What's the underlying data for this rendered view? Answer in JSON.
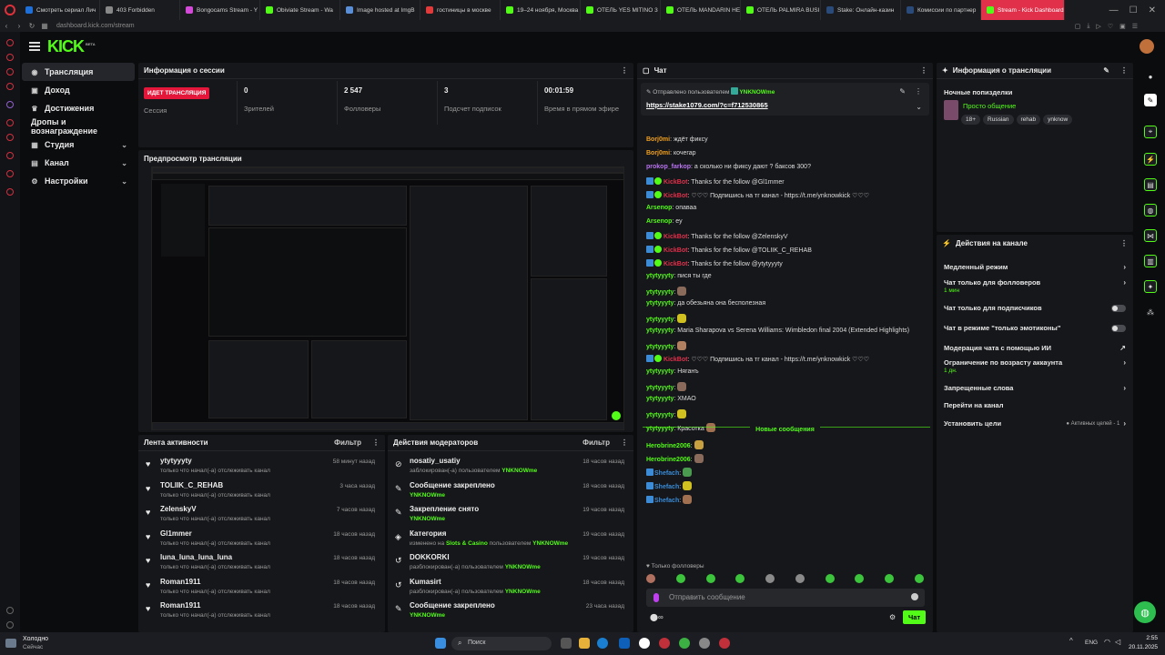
{
  "browser": {
    "tabs": [
      {
        "label": "Смотреть сериал Лич",
        "fav": "#1f6fd8"
      },
      {
        "label": "403 Forbidden",
        "fav": "#888888"
      },
      {
        "label": "Bongocams Stream - Y",
        "fav": "#d34ad8"
      },
      {
        "label": "Obiviate Stream - Wa",
        "fav": "#53fc18"
      },
      {
        "label": "Image hosted at ImgB",
        "fav": "#5a8fd8"
      },
      {
        "label": "гостиницы в москве",
        "fav": "#e03a3a"
      },
      {
        "label": "19–24 ноября, Москва",
        "fav": "#53fc18"
      },
      {
        "label": "ОТЕЛЬ YES MITINO 3",
        "fav": "#53fc18"
      },
      {
        "label": "ОТЕЛЬ MANDARIN НЕ",
        "fav": "#53fc18"
      },
      {
        "label": "ОТЕЛЬ PALMIRA BUSI",
        "fav": "#53fc18"
      },
      {
        "label": "Stake: Онлайн-казин",
        "fav": "#2a4a7a"
      },
      {
        "label": "Комиссии по партнер",
        "fav": "#2a4a7a"
      },
      {
        "label": "Stream - Kick Dashboard",
        "fav": "#53fc18",
        "active": true
      }
    ],
    "url": "dashboard.kick.com/stream"
  },
  "logo": "KICK",
  "logo_sup": "BETA",
  "nav": {
    "items": [
      {
        "label": "Трансляция",
        "icon": "broadcast-icon",
        "glyph": "◉",
        "active": true
      },
      {
        "label": "Доход",
        "icon": "money-icon",
        "glyph": "▣"
      },
      {
        "label": "Достижения",
        "icon": "trophy-icon",
        "glyph": "♛"
      },
      {
        "label": "Дропы и вознаграждение",
        "icon": "",
        "glyph": ""
      },
      {
        "label": "Студия",
        "icon": "studio-icon",
        "glyph": "▦",
        "chevron": true
      },
      {
        "label": "Канал",
        "icon": "channel-icon",
        "glyph": "▤",
        "chevron": true
      },
      {
        "label": "Настройки",
        "icon": "settings-icon",
        "glyph": "⚙",
        "chevron": true
      }
    ]
  },
  "session": {
    "title": "Информация о сессии",
    "live_badge": "ИДЕТ ТРАНСЛЯЦИЯ",
    "session_label": "Сессия",
    "stats": [
      {
        "value": "0",
        "label": "Зрителей"
      },
      {
        "value": "2 547",
        "label": "Фолловеры"
      },
      {
        "value": "3",
        "label": "Подсчет подписок"
      },
      {
        "value": "00:01:59",
        "label": "Время в прямом эфире"
      }
    ]
  },
  "preview": {
    "title": "Предпросмотр трансляции"
  },
  "activity": {
    "title": "Лента активности",
    "filter": "Фильтр",
    "items": [
      {
        "name": "ytytyyyty",
        "sub": "только что начал(-а) отслеживать канал",
        "time": "58 минут назад"
      },
      {
        "name": "TOLIIK_C_REHAB",
        "sub": "только что начал(-а) отслеживать канал",
        "time": "3 часа назад"
      },
      {
        "name": "ZelenskyV",
        "sub": "только что начал(-а) отслеживать канал",
        "time": "7 часов назад"
      },
      {
        "name": "Gl1mmer",
        "sub": "только что начал(-а) отслеживать канал",
        "time": "18 часов назад"
      },
      {
        "name": "luna_luna_luna_luna",
        "sub": "только что начал(-а) отслеживать канал",
        "time": "18 часов назад"
      },
      {
        "name": "Roman1911",
        "sub": "только что начал(-а) отслеживать канал",
        "time": "18 часов назад"
      },
      {
        "name": "Roman1911",
        "sub": "только что начал(-а) отслеживать канал",
        "time": "18 часов назад"
      }
    ]
  },
  "moderators": {
    "title": "Действия модераторов",
    "filter": "Фильтр",
    "items": [
      {
        "name": "nosatiy_usatiy",
        "sub": "заблокирован(-а) пользователем",
        "user": "YNKNOWme",
        "time": "18 часов назад",
        "icon": "ban-icon",
        "glyph": "⊘"
      },
      {
        "name": "Сообщение закреплено",
        "sub": "",
        "user": "YNKNOWme",
        "time": "18 часов назад",
        "icon": "pin-icon",
        "glyph": "✎"
      },
      {
        "name": "Закрепление снято",
        "sub": "",
        "user": "YNKNOWme",
        "time": "19 часов назад",
        "icon": "unpin-icon",
        "glyph": "✎"
      },
      {
        "name": "Категория",
        "sub": "изменено на",
        "user": "YNKNOWme",
        "extra": "Slots & Casino",
        "extra_suffix": "пользователем",
        "time": "19 часов назад",
        "icon": "category-icon",
        "glyph": "◈"
      },
      {
        "name": "DOKKORKI",
        "sub": "разблокирован(-а) пользователем",
        "user": "YNKNOWme",
        "time": "19 часов назад",
        "icon": "unban-icon",
        "glyph": "↺"
      },
      {
        "name": "Kumasirt",
        "sub": "разблокирован(-а) пользователем",
        "user": "YNKNOWme",
        "time": "18 часов назад",
        "icon": "unban-icon",
        "glyph": "↺"
      },
      {
        "name": "Сообщение закреплено",
        "sub": "",
        "user": "YNKNOWme",
        "time": "23 часа назад",
        "icon": "pin-icon",
        "glyph": "✎"
      }
    ]
  },
  "chat": {
    "title": "Чат",
    "pinned_by": "Отправлено пользователем",
    "pinned_user": "YNKNOWme",
    "pinned_link": "https://stake1079.com/?c=f712530865",
    "new_messages": "Новые сообщения",
    "followers_only": "Только фолловеры",
    "input_placeholder": "Отправить сообщение",
    "send": "Чат",
    "lines": [
      {
        "user": "Borj0mi",
        "color": "#f0a020",
        "text": ": ждёт фиксу"
      },
      {
        "user": "Borj0mi",
        "color": "#f0a020",
        "text": ": кочегар"
      },
      {
        "user": "prokop_farkop",
        "color": "#b874f0",
        "text": ": а сколько ни фиксу дают ? баксов 300?"
      },
      {
        "user": "KickBot",
        "color": "#e0304a",
        "text": ": Thanks for the follow @Gl1mmer",
        "bot": true
      },
      {
        "user": "KickBot",
        "color": "#e0304a",
        "text": ": ♡♡♡ Подпишись на тг канал - https://t.me/ynknowkick ♡♡♡",
        "bot": true
      },
      {
        "user": "Arsenop",
        "color": "#53fc18",
        "text": ": опаваа"
      },
      {
        "user": "Arsenop",
        "color": "#53fc18",
        "text": ": еу"
      },
      {
        "user": "KickBot",
        "color": "#e0304a",
        "text": ": Thanks for the follow @ZelenskyV",
        "bot": true
      },
      {
        "user": "KickBot",
        "color": "#e0304a",
        "text": ": Thanks for the follow @TOLIIK_C_REHAB",
        "bot": true
      },
      {
        "user": "KickBot",
        "color": "#e0304a",
        "text": ": Thanks for the follow @ytytyyyty",
        "bot": true
      },
      {
        "user": "ytytyyyty",
        "color": "#53fc18",
        "text": ": пися ты где"
      },
      {
        "user": "ytytyyyty",
        "color": "#53fc18",
        "text": ":"
      },
      {
        "user": "ytytyyyty",
        "color": "#53fc18",
        "text": ": да обезьяна она бесполезная"
      },
      {
        "user": "ytytyyyty",
        "color": "#53fc18",
        "text": ":"
      },
      {
        "user": "ytytyyyty",
        "color": "#53fc18",
        "text": ": Maria Sharapova vs Serena Williams: Wimbledon final 2004 (Extended Highlights)"
      },
      {
        "user": "ytytyyyty",
        "color": "#53fc18",
        "text": ":"
      },
      {
        "user": "KickBot",
        "color": "#e0304a",
        "text": ": ♡♡♡ Подпишись на тг канал - https://t.me/ynknowkick ♡♡♡",
        "bot": true
      },
      {
        "user": "ytytyyyty",
        "color": "#53fc18",
        "text": ": Няганъ"
      },
      {
        "user": "ytytyyyty",
        "color": "#53fc18",
        "text": ":"
      },
      {
        "user": "ytytyyyty",
        "color": "#53fc18",
        "text": ": ХМАО"
      },
      {
        "user": "ytytyyyty",
        "color": "#53fc18",
        "text": ":"
      },
      {
        "user": "ytytyyyty",
        "color": "#53fc18",
        "text": ": Красотка"
      }
    ],
    "new_lines": [
      {
        "user": "Herobrine2006",
        "color": "#53fc18",
        "text": ":"
      },
      {
        "user": "Herobrine2006",
        "color": "#53fc18",
        "text": ":"
      },
      {
        "user": "Shefach",
        "color": "#3b8bd6",
        "text": ":",
        "sq": true
      },
      {
        "user": "Shefach",
        "color": "#3b8bd6",
        "text": ":",
        "sq": true
      },
      {
        "user": "Shefach",
        "color": "#3b8bd6",
        "text": ":",
        "sq": true
      }
    ]
  },
  "stream_info": {
    "title": "Информация о трансляции",
    "stream_title": "Ночные попизделки",
    "category": "Просто общение",
    "tags": [
      "18+",
      "Russian",
      "rehab",
      "ynknow"
    ]
  },
  "channel_actions": {
    "title": "Действия на канале",
    "rows": [
      {
        "label": "Медленный режим",
        "kind": "chevron"
      },
      {
        "label": "Чат только для фолловеров",
        "sub": "1 мин",
        "kind": "chevron"
      },
      {
        "label": "Чат только для подписчиков",
        "kind": "toggle"
      },
      {
        "label": "Чат в режиме \"только эмотиконы\"",
        "kind": "toggle"
      },
      {
        "label": "Модерация чата с помощью ИИ",
        "kind": "external"
      },
      {
        "label": "Ограничение по возрасту аккаунта",
        "sub": "1 дн.",
        "kind": "chevron"
      },
      {
        "label": "Запрещенные слова",
        "kind": "chevron"
      },
      {
        "label": "Перейти на канал",
        "kind": "none"
      },
      {
        "label": "Установить цели",
        "extra": "● Активных целей - 1",
        "kind": "chevron"
      }
    ]
  },
  "taskbar": {
    "weather_title": "Холодно",
    "weather_sub": "Сейчас",
    "search": "Поиск",
    "lang": "ENG",
    "time": "2:55",
    "date": "20.11.2025"
  }
}
